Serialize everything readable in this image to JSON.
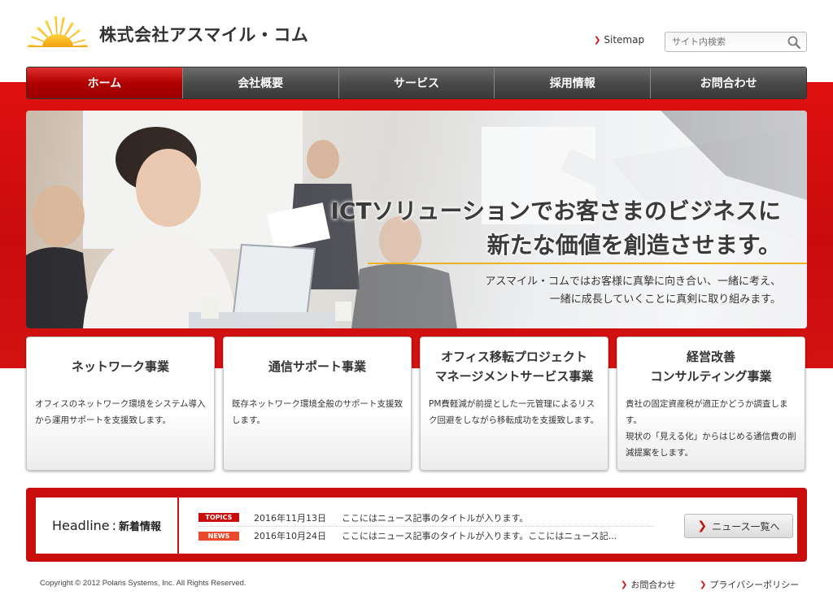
{
  "header": {
    "company_name": "株式会社アスマイル・コム",
    "sitemap_label": "Sitemap",
    "search_placeholder": "サイト内検索"
  },
  "nav": {
    "items": [
      {
        "label": "ホーム",
        "active": true
      },
      {
        "label": "会社概要",
        "active": false
      },
      {
        "label": "サービス",
        "active": false
      },
      {
        "label": "採用情報",
        "active": false
      },
      {
        "label": "お問合わせ",
        "active": false
      }
    ]
  },
  "hero": {
    "heading_line1": "ICTソリューションでお客さまのビジネスに",
    "heading_line2": "新たな価値を創造させます。",
    "sub_line1": "アスマイル・コムではお客様に真摯に向き合い、一緒に考え、",
    "sub_line2": "一緒に成長していくことに真剣に取り組みます。"
  },
  "services": [
    {
      "title_line1": "ネットワーク事業",
      "title_line2": "",
      "text": "オフィスのネットワーク環境をシステム導入から運用サポートを支援致します。"
    },
    {
      "title_line1": "通信サポート事業",
      "title_line2": "",
      "text": "既存ネットワーク環境全般のサポート支援致します。"
    },
    {
      "title_line1": "オフィス移転プロジェクト",
      "title_line2": "マネージメントサービス事業",
      "text": "PM費軽減が前提とした一元管理によるリスク回避をしながら移転成功を支援致します。"
    },
    {
      "title_line1": "経営改善",
      "title_line2": "コンサルティング事業",
      "text_line1": "貴社の固定資産税が適正かどうか調査します。",
      "text_line2": "現状の「見える化」からはじめる通信費の削減提案をします。"
    }
  ],
  "headline": {
    "label_en": "Headline",
    "label_sep": ":",
    "label_jp": "新着情報",
    "items": [
      {
        "badge": "TOPICS",
        "date": "2016年11月13日",
        "title": "ここにはニュース記事のタイトルが入ります。"
      },
      {
        "badge": "NEWS",
        "date": "2016年10月24日",
        "title": "ここにはニュース記事のタイトルが入ります。ここにはニュース記..."
      }
    ],
    "all_news_label": "ニュース一覧へ"
  },
  "footer": {
    "copyright": "Copyright © 2012 Polaris Systems, Inc. All Rights Reserved.",
    "contact_label": "お問合わせ",
    "privacy_label": "プライバシーポリシー"
  },
  "colors": {
    "brand_red": "#c90c0c",
    "accent_gold": "#f0b020",
    "nav_dark": "#4a4a4a"
  }
}
